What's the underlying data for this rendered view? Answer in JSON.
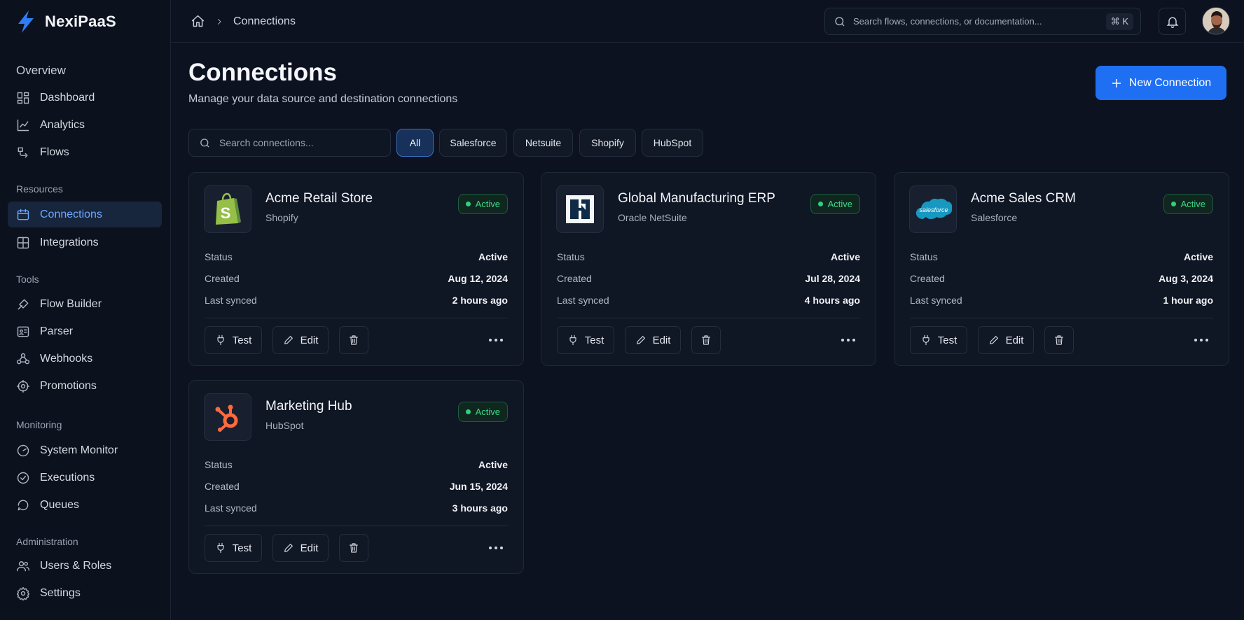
{
  "app": {
    "name": "NexiPaaS"
  },
  "sidebar": {
    "overview_title": "Overview",
    "overview_items": [
      {
        "label": "Dashboard",
        "icon": "dashboard-icon"
      },
      {
        "label": "Analytics",
        "icon": "analytics-icon"
      },
      {
        "label": "Flows",
        "icon": "flows-icon"
      }
    ],
    "resources_title": "Resources",
    "resources_items": [
      {
        "label": "Connections",
        "icon": "connections-icon",
        "active": true
      },
      {
        "label": "Integrations",
        "icon": "integrations-icon"
      }
    ],
    "tools_title": "Tools",
    "tools_items": [
      {
        "label": "Flow Builder",
        "icon": "flow-builder-icon"
      },
      {
        "label": "Parser",
        "icon": "parser-icon"
      },
      {
        "label": "Webhooks",
        "icon": "webhooks-icon"
      },
      {
        "label": "Promotions",
        "icon": "promotions-icon"
      }
    ],
    "monitoring_title": "Monitoring",
    "monitoring_items": [
      {
        "label": "System Monitor",
        "icon": "system-monitor-icon"
      },
      {
        "label": "Executions",
        "icon": "executions-icon"
      },
      {
        "label": "Queues",
        "icon": "queues-icon"
      }
    ],
    "administration_title": "Administration",
    "administration_items": [
      {
        "label": "Users & Roles",
        "icon": "users-icon"
      },
      {
        "label": "Settings",
        "icon": "settings-icon"
      }
    ]
  },
  "topbar": {
    "breadcrumb": "Connections",
    "search_placeholder": "Search flows, connections, or documentation...",
    "shortcut": "⌘ K"
  },
  "page": {
    "title": "Connections",
    "subtitle": "Manage your data source and destination connections",
    "new_button": "New Connection",
    "search_placeholder": "Search connections...",
    "filters": [
      "All",
      "Salesforce",
      "Netsuite",
      "Shopify",
      "HubSpot"
    ],
    "active_filter": "All"
  },
  "labels": {
    "status": "Status",
    "created": "Created",
    "last_synced": "Last synced",
    "test": "Test",
    "edit": "Edit"
  },
  "connections": [
    {
      "name": "Acme Retail Store",
      "platform": "Shopify",
      "badge": "Active",
      "status": "Active",
      "created": "Aug 12, 2024",
      "last_synced": "2 hours ago",
      "logo": "shopify-logo"
    },
    {
      "name": "Global Manufacturing ERP",
      "platform": "Oracle NetSuite",
      "badge": "Active",
      "status": "Active",
      "created": "Jul 28, 2024",
      "last_synced": "4 hours ago",
      "logo": "netsuite-logo"
    },
    {
      "name": "Acme Sales CRM",
      "platform": "Salesforce",
      "badge": "Active",
      "status": "Active",
      "created": "Aug 3, 2024",
      "last_synced": "1 hour ago",
      "logo": "salesforce-logo",
      "logo_text": "salesforce"
    },
    {
      "name": "Marketing Hub",
      "platform": "HubSpot",
      "badge": "Active",
      "status": "Active",
      "created": "Jun 15, 2024",
      "last_synced": "3 hours ago",
      "logo": "hubspot-logo"
    }
  ],
  "colors": {
    "accent": "#1f6ff2",
    "active_green": "#3fd489",
    "background": "#0c1220"
  }
}
